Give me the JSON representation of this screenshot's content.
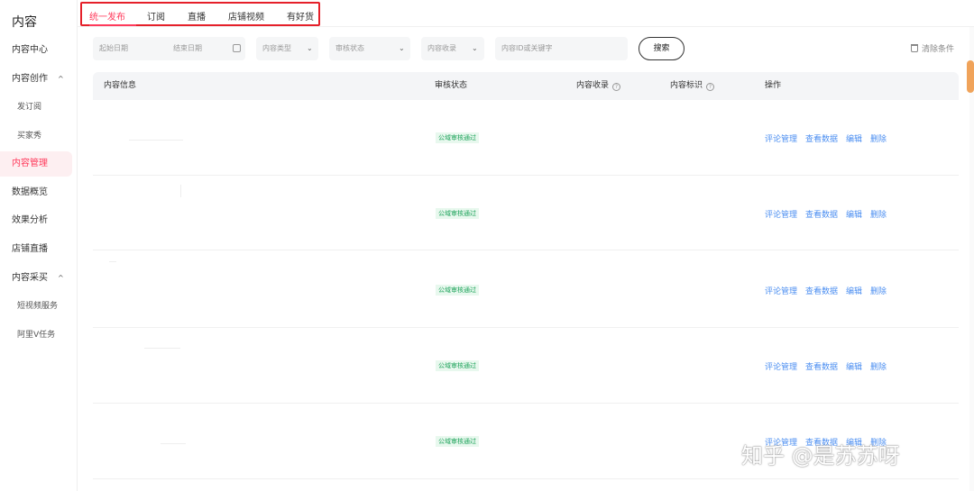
{
  "sidebar": {
    "title": "内容",
    "items": [
      {
        "label": "内容中心"
      },
      {
        "label": "内容创作",
        "caret": "^"
      },
      {
        "label": "发订阅"
      },
      {
        "label": "买家秀"
      },
      {
        "label": "内容管理"
      },
      {
        "label": "数据概览"
      },
      {
        "label": "效果分析"
      },
      {
        "label": "店铺直播"
      },
      {
        "label": "内容采买",
        "caret": "^"
      },
      {
        "label": "短视频服务"
      },
      {
        "label": "阿里V任务"
      }
    ]
  },
  "tabs": [
    {
      "label": "统一发布",
      "active": true
    },
    {
      "label": "订阅"
    },
    {
      "label": "直播"
    },
    {
      "label": "店铺视频"
    },
    {
      "label": "有好货"
    }
  ],
  "filters": {
    "start_date": "起始日期",
    "end_date": "结束日期",
    "content_type": "内容类型",
    "review_status": "审核状态",
    "content_collect": "内容收录",
    "search_placeholder": "内容ID或关键字",
    "search_button": "搜索",
    "clear": "清除条件"
  },
  "table": {
    "columns": [
      {
        "label": "内容信息"
      },
      {
        "label": "审核状态"
      },
      {
        "label": "内容收录",
        "help": "?"
      },
      {
        "label": "内容标识",
        "help": "?"
      },
      {
        "label": "操作"
      }
    ],
    "rows": [
      {
        "status": "公域审核通过",
        "actions": [
          "评论管理",
          "查看数据",
          "编辑",
          "删除"
        ]
      },
      {
        "status": "公域审核通过",
        "actions": [
          "评论管理",
          "查看数据",
          "编辑",
          "删除"
        ]
      },
      {
        "status": "公域审核通过",
        "actions": [
          "评论管理",
          "查看数据",
          "编辑",
          "删除"
        ]
      },
      {
        "status": "公域审核通过",
        "actions": [
          "评论管理",
          "查看数据",
          "编辑",
          "删除"
        ]
      },
      {
        "status": "公域审核通过",
        "actions": [
          "评论管理",
          "查看数据",
          "编辑",
          "删除"
        ]
      }
    ]
  },
  "watermark": "知乎 @是苏苏呀",
  "icons": {
    "calendar": "calendar-icon",
    "chevron": "chevron-down-icon",
    "trash": "trash-icon",
    "help": "question-icon"
  },
  "colors": {
    "accent": "#ff3b5c",
    "link": "#4b8ef1",
    "badge_text": "#1ea35b",
    "badge_bg": "#e8f8ee",
    "highlight_box": "#e5202a"
  }
}
